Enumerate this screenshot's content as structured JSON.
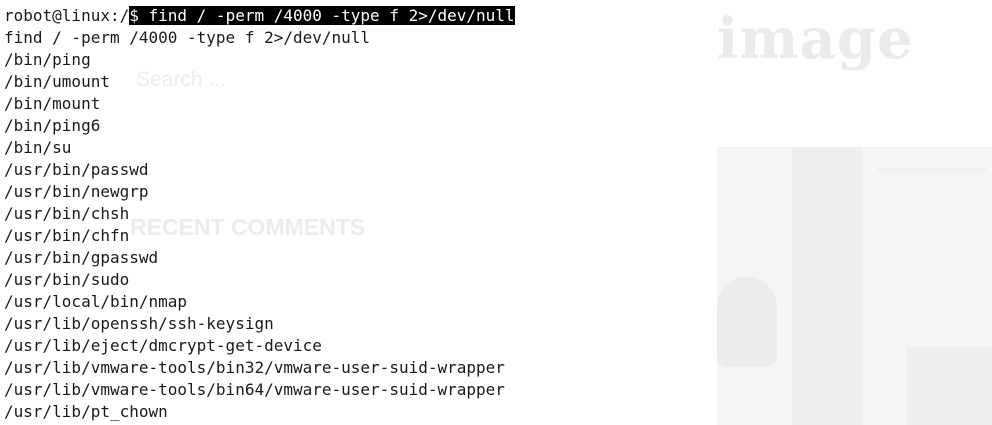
{
  "background_page": {
    "title": "image",
    "search_placeholder": "Search ...",
    "heading": "RECENT COMMENTS"
  },
  "terminal": {
    "prompt": "robot@linux:/",
    "command": "$ find / -perm /4000 -type f 2>/dev/null",
    "output": [
      "find / -perm /4000 -type f 2>/dev/null",
      "/bin/ping",
      "/bin/umount",
      "/bin/mount",
      "/bin/ping6",
      "/bin/su",
      "/usr/bin/passwd",
      "/usr/bin/newgrp",
      "/usr/bin/chsh",
      "/usr/bin/chfn",
      "/usr/bin/gpasswd",
      "/usr/bin/sudo",
      "/usr/local/bin/nmap",
      "/usr/lib/openssh/ssh-keysign",
      "/usr/lib/eject/dmcrypt-get-device",
      "/usr/lib/vmware-tools/bin32/vmware-user-suid-wrapper",
      "/usr/lib/vmware-tools/bin64/vmware-user-suid-wrapper",
      "/usr/lib/pt_chown"
    ],
    "colors": {
      "text": "#1a1a1a",
      "highlight_bg": "#000000",
      "highlight_fg": "#ffffff"
    }
  }
}
